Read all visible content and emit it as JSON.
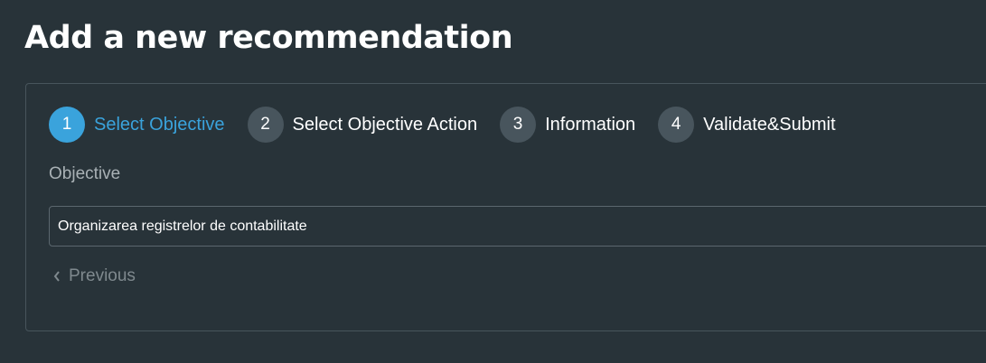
{
  "page": {
    "title": "Add a new recommendation"
  },
  "steps": [
    {
      "number": "1",
      "label": "Select Objective",
      "active": true
    },
    {
      "number": "2",
      "label": "Select Objective Action",
      "active": false
    },
    {
      "number": "3",
      "label": "Information",
      "active": false
    },
    {
      "number": "4",
      "label": "Validate&Submit",
      "active": false
    }
  ],
  "form": {
    "objective_label": "Objective",
    "objective_value": "Organizarea registrelor de contabilitate",
    "previous_label": "Previous",
    "previous_icon": "chevron-left-icon"
  },
  "colors": {
    "background": "#283339",
    "accent": "#3aa3dc",
    "inactive_step": "#48555d"
  }
}
